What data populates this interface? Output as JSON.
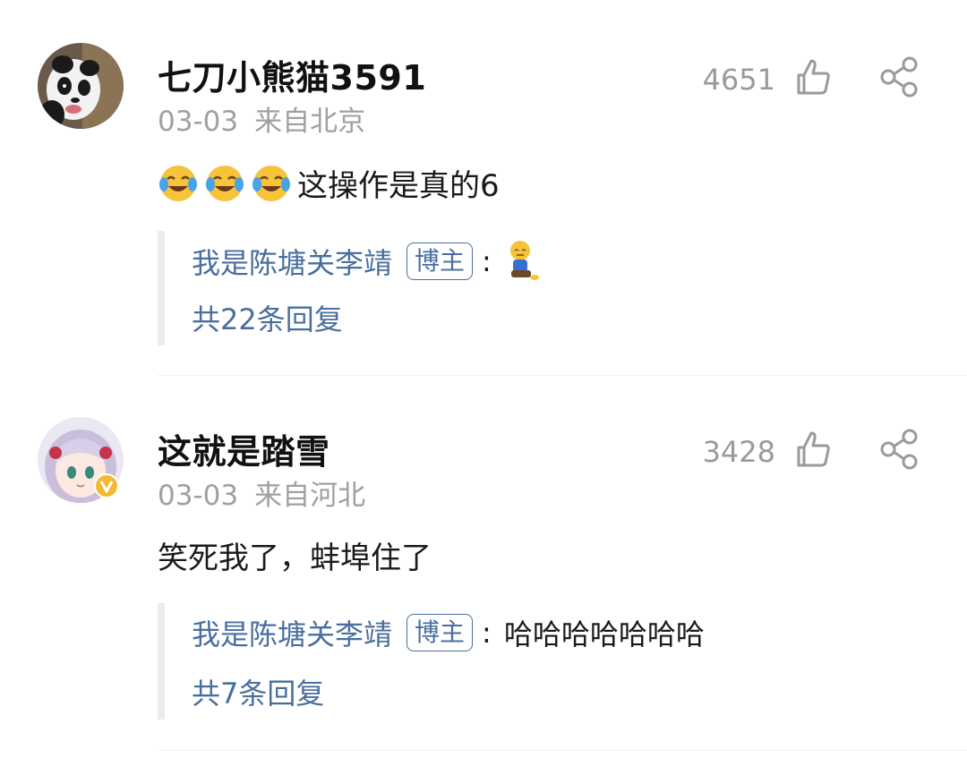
{
  "comments": [
    {
      "username": "七刀小熊猫3591",
      "date": "03-03",
      "location": "来自北京",
      "likes": "4651",
      "text": "这操作是真的6",
      "emojis": [
        "laugh-cry-emoji",
        "laugh-cry-emoji",
        "laugh-cry-emoji"
      ],
      "reply": {
        "author": "我是陈塘关李靖",
        "badge": "博主",
        "colon": ":",
        "text": "",
        "emoji": "sitting-person-emoji"
      },
      "more_replies": "共22条回复"
    },
    {
      "username": "这就是踏雪",
      "date": "03-03",
      "location": "来自河北",
      "likes": "3428",
      "text": "笑死我了，蚌埠住了",
      "reply": {
        "author": "我是陈塘关李靖",
        "badge": "博主",
        "colon": ":",
        "text": "哈哈哈哈哈哈哈"
      },
      "more_replies": "共7条回复"
    }
  ],
  "icons": {
    "like": "thumbs-up-icon",
    "share": "share-icon",
    "verified": "verified-v-badge"
  },
  "colors": {
    "link": "#4a6f9e",
    "meta": "#a0a0a0",
    "reply_bar": "#ececec",
    "verified": "#f5b82e"
  }
}
